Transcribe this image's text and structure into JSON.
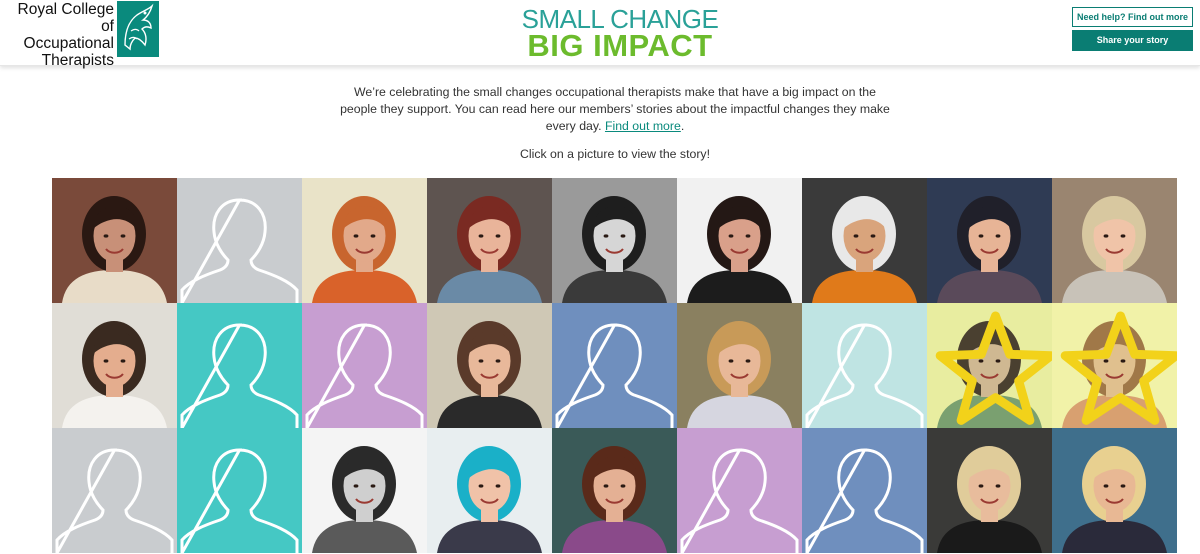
{
  "header": {
    "org_name_line1": "Royal College of",
    "org_name_line2": "Occupational",
    "org_name_line3": "Therapists",
    "brand_line1": "SMALL CHANGE",
    "brand_line2": "BIG IMPACT",
    "help_button": "Need help? Find out more",
    "share_button": "Share your story"
  },
  "intro": {
    "text": "We’re celebrating the small changes occupational therapists make that have a big impact on the people they support. You can read here our members’ stories about the impactful changes they make every day. ",
    "link": "Find out more",
    "link_suffix": ".",
    "click_hint": "Click on a picture to view the story!"
  },
  "colors": {
    "brand_teal": "#0a7d73",
    "brand_green": "#6cbb2d",
    "link": "#0a8a7d"
  },
  "tiles": [
    {
      "kind": "photo",
      "bg": "#7a4a3a",
      "skin": "#c89078",
      "hair": "#2a1812",
      "shirt": "#e8dcc8"
    },
    {
      "kind": "placeholder",
      "bg": "#c9cccf"
    },
    {
      "kind": "photo",
      "bg": "#e9e3c8",
      "skin": "#e2a98a",
      "hair": "#c8652e",
      "shirt": "#d9622a"
    },
    {
      "kind": "photo",
      "bg": "#5e5450",
      "skin": "#e9b49a",
      "hair": "#7a2a22",
      "shirt": "#6a8aa6"
    },
    {
      "kind": "photo",
      "bg": "#9a9a9a",
      "skin": "#d6d6d6",
      "hair": "#1e1e1e",
      "shirt": "#3a3a3a"
    },
    {
      "kind": "photo",
      "bg": "#f1f1f1",
      "skin": "#d9a08a",
      "hair": "#241815",
      "shirt": "#1c1c1c"
    },
    {
      "kind": "photo",
      "bg": "#3a3a3a",
      "skin": "#d9a47c",
      "hair": "#e8e8e8",
      "shirt": "#e07a1a"
    },
    {
      "kind": "photo",
      "bg": "#2f3b54",
      "skin": "#e7b496",
      "hair": "#20202a",
      "shirt": "#5a4a5a"
    },
    {
      "kind": "photo",
      "bg": "#9a8570",
      "skin": "#f0c4a8",
      "hair": "#d8c8a0",
      "shirt": "#c8c2b8"
    },
    {
      "kind": "photo",
      "bg": "#e0ddd6",
      "skin": "#e4ad8e",
      "hair": "#3a2a20",
      "shirt": "#f4f2ee"
    },
    {
      "kind": "placeholder",
      "bg": "#45c8c4"
    },
    {
      "kind": "placeholder",
      "bg": "#c79ed1"
    },
    {
      "kind": "photo",
      "bg": "#cfc8b5",
      "skin": "#e8b89a",
      "hair": "#5a3a2a",
      "shirt": "#2a2a2a"
    },
    {
      "kind": "placeholder",
      "bg": "#6f8fbe"
    },
    {
      "kind": "photo",
      "bg": "#8a8060",
      "skin": "#e8b898",
      "hair": "#c89a58",
      "shirt": "#d6d6e0"
    },
    {
      "kind": "placeholder",
      "bg": "#bfe4e3"
    },
    {
      "kind": "photo",
      "bg": "#e8eda0",
      "skin": "#cfb892",
      "hair": "#4a4030",
      "shirt": "#7aa070",
      "star": true
    },
    {
      "kind": "photo",
      "bg": "#f1f2a8",
      "skin": "#e0c08e",
      "hair": "#a07848",
      "shirt": "#d8a070",
      "star": true
    },
    {
      "kind": "placeholder",
      "bg": "#c9cccf"
    },
    {
      "kind": "placeholder",
      "bg": "#45c8c4"
    },
    {
      "kind": "photo",
      "bg": "#f4f4f4",
      "skin": "#cfcfcf",
      "hair": "#2a2a2a",
      "shirt": "#5a5a5a"
    },
    {
      "kind": "photo",
      "bg": "#e8eef0",
      "skin": "#f0c2a8",
      "hair": "#1ab0c8",
      "shirt": "#3a3a4a"
    },
    {
      "kind": "photo",
      "bg": "#3a5a58",
      "skin": "#e4b094",
      "hair": "#5a2a1a",
      "shirt": "#8a4a8a"
    },
    {
      "kind": "placeholder",
      "bg": "#c79ed1"
    },
    {
      "kind": "placeholder",
      "bg": "#6f8fbe"
    },
    {
      "kind": "photo",
      "bg": "#3a3a38",
      "skin": "#e8bc9c",
      "hair": "#e0cc9a",
      "shirt": "#1a1a1a"
    },
    {
      "kind": "photo",
      "bg": "#3f6f8c",
      "skin": "#e8b894",
      "hair": "#e8d090",
      "shirt": "#2a2a3a"
    }
  ]
}
